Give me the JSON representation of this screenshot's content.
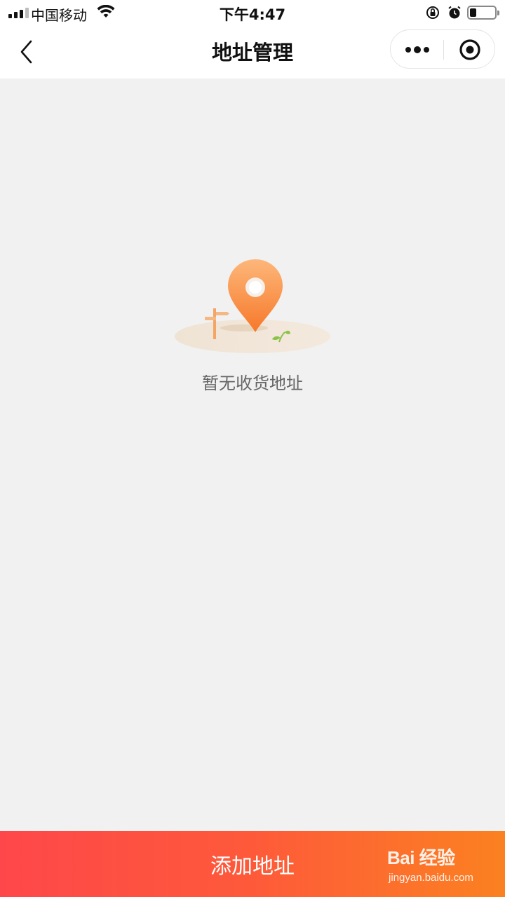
{
  "status_bar": {
    "carrier": "中国移动",
    "time": "下午4:47"
  },
  "nav": {
    "title": "地址管理"
  },
  "empty_state": {
    "message": "暂无收货地址"
  },
  "footer": {
    "add_button_label": "添加地址"
  },
  "watermark": {
    "logo_text": "Bai 经验",
    "url": "jingyan.baidu.com"
  },
  "colors": {
    "accent_start": "#fe474a",
    "accent_end": "#fb8120",
    "pin_orange": "#f6893b"
  }
}
